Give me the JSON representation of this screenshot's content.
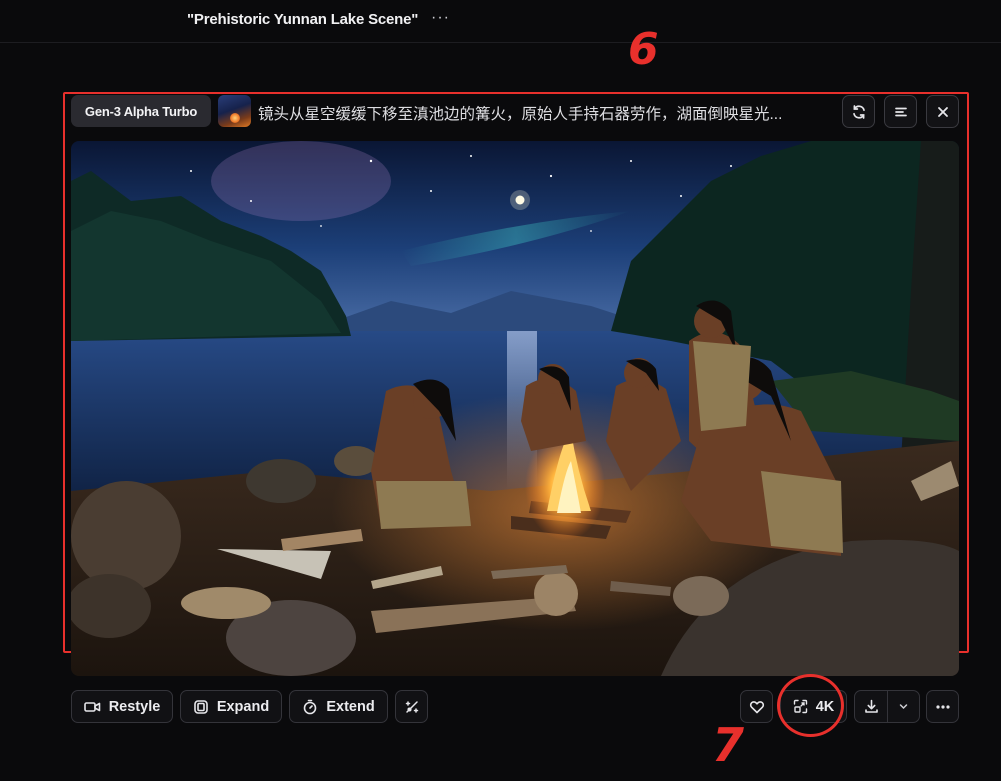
{
  "header": {
    "title": "\"Prehistoric Yunnan Lake Scene\"",
    "more_label": "···"
  },
  "generation": {
    "model": "Gen-3 Alpha Turbo",
    "prompt": "镜头从星空缓缓下移至滇池边的篝火，原始人手持石器劳作，湖面倒映星光..."
  },
  "header_actions": [
    "refresh-icon",
    "menu-lines-icon",
    "close-icon"
  ],
  "toolbar": {
    "restyle_label": "Restyle",
    "expand_label": "Expand",
    "extend_label": "Extend",
    "upscale_label": "4K"
  },
  "annotations": {
    "mark_6": "6",
    "mark_7": "7",
    "color": "#e8302c"
  },
  "colors": {
    "background": "#0a0a0c",
    "button_border": "#34343a",
    "chip_bg": "#2a2a30"
  }
}
